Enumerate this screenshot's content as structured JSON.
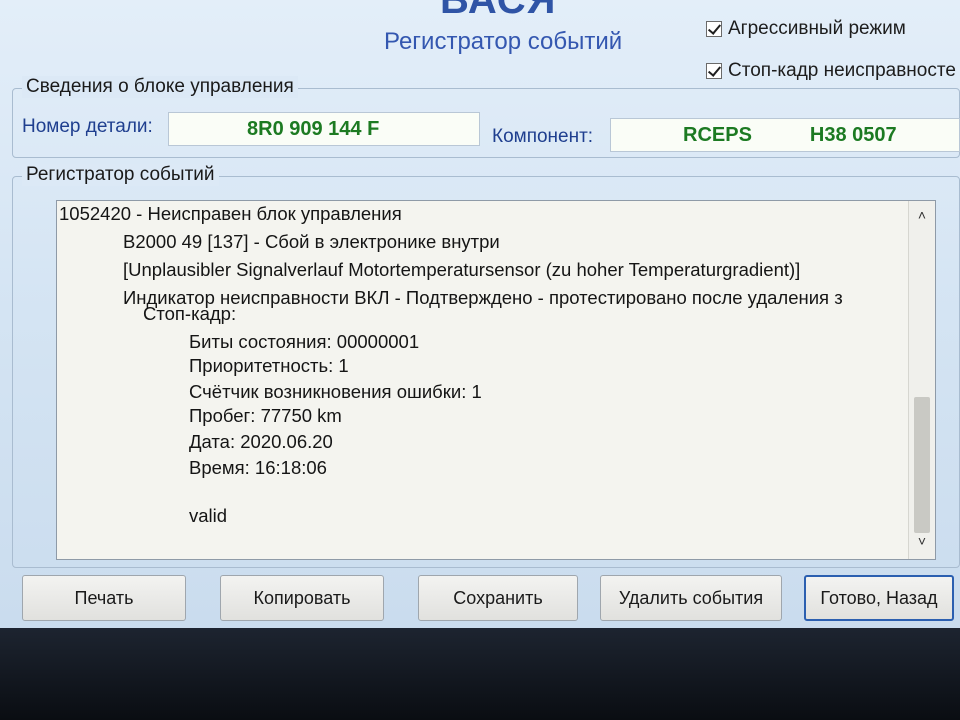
{
  "header": {
    "brand": "ВАСЯ",
    "title": "Регистратор событий"
  },
  "options": {
    "aggressive_mode": {
      "label": "Агрессивный режим",
      "checked": true
    },
    "freeze_frame": {
      "label": "Стоп-кадр неисправносте",
      "checked": true
    }
  },
  "control_unit": {
    "group_label": "Сведения о блоке управления",
    "part_number_label": "Номер детали:",
    "part_number_value": "8R0 909 144 F",
    "component_label": "Компонент:",
    "component_value_1": "RCEPS",
    "component_value_2": "H38 0507"
  },
  "event_log": {
    "group_label": "Регистратор событий",
    "lines": [
      "1052420 - Неисправен блок управления",
      "B2000 49 [137] - Сбой в электронике внутри",
      "[Unplausibler Signalverlauf Motortemperatursensor (zu hoher Temperaturgradient)]",
      "Индикатор неисправности ВКЛ - Подтверждено - протестировано после удаления з",
      "Стоп-кадр:",
      "Биты состояния: 00000001",
      "Приоритетность: 1",
      "Счётчик возникновения ошибки: 1",
      "Пробег: 77750 km",
      "Дата: 2020.06.20",
      "Время: 16:18:06",
      "valid"
    ]
  },
  "buttons": {
    "print": "Печать",
    "copy": "Копировать",
    "save": "Сохранить",
    "delete_events": "Удалить события",
    "done_back": "Готово, Назад"
  },
  "colors": {
    "accent": "#3457b0",
    "value_green": "#1c7a22",
    "primary_border": "#2b5fb0"
  }
}
